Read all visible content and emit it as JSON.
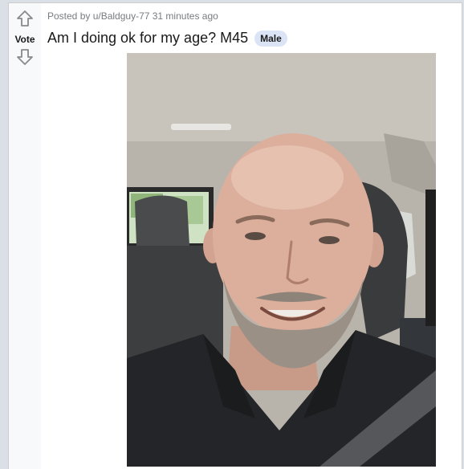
{
  "post": {
    "meta": "Posted by u/Baldguy-77 31 minutes ago",
    "title": "Am I doing ok for my age? M45",
    "flair": "Male",
    "vote_label": "Vote"
  },
  "icons": {
    "upvote": "arrow-up-icon",
    "downvote": "arrow-down-icon"
  },
  "colors": {
    "flair_bg": "#dbe4f5",
    "meta_text": "#787c7e",
    "title_text": "#1a1a1b"
  },
  "image": {
    "description_name": "selfie-photo"
  }
}
